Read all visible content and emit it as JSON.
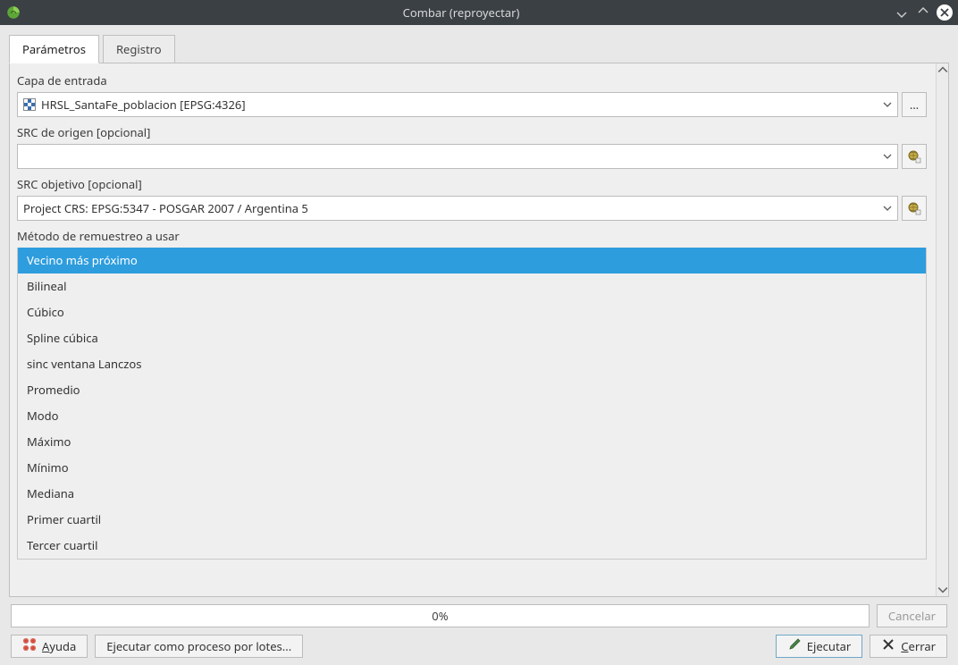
{
  "window": {
    "title": "Combar (reproyectar)"
  },
  "tabs": {
    "parameters": "Parámetros",
    "log": "Registro",
    "active": "parameters"
  },
  "labels": {
    "input_layer": "Capa de entrada",
    "source_crs": "SRC de origen [opcional]",
    "target_crs": "SRC objetivo [opcional]",
    "resample": "Método de remuestreo a usar"
  },
  "fields": {
    "input_layer_value": "HRSL_SantaFe_poblacion [EPSG:4326]",
    "source_crs_value": "",
    "target_crs_value": "Project CRS: EPSG:5347 - POSGAR 2007 / Argentina 5"
  },
  "resample": {
    "selected_index": 0,
    "options": [
      "Vecino más próximo",
      "Bilineal",
      "Cúbico",
      "Spline cúbica",
      "sinc ventana Lanczos",
      "Promedio",
      "Modo",
      "Máximo",
      "Mínimo",
      "Mediana",
      "Primer cuartil",
      "Tercer cuartil"
    ]
  },
  "progress": {
    "text": "0%"
  },
  "buttons": {
    "cancel": "Cancelar",
    "help": "Ayuda",
    "batch": "Ejecutar como proceso por lotes...",
    "run": "Ejecutar",
    "close": "Cerrar",
    "more": "…"
  }
}
